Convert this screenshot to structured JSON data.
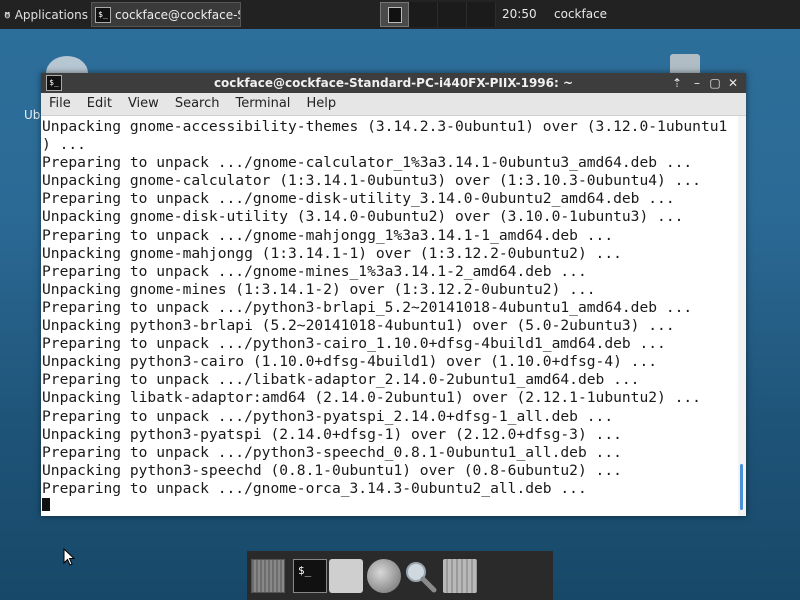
{
  "top_panel": {
    "applications_label": "Applications",
    "task_label": "cockface@cockface-Sta…",
    "clock": "20:50",
    "user": "cockface"
  },
  "desktop": {
    "icon_label_fragment": "Ub an"
  },
  "window": {
    "title": "cockface@cockface-Standard-PC-i440FX-PIIX-1996: ~",
    "menu": [
      "File",
      "Edit",
      "View",
      "Search",
      "Terminal",
      "Help"
    ],
    "lines": [
      "Unpacking gnome-accessibility-themes (3.14.2.3-0ubuntu1) over (3.12.0-1ubuntu1",
      ") ...",
      "Preparing to unpack .../gnome-calculator_1%3a3.14.1-0ubuntu3_amd64.deb ...",
      "Unpacking gnome-calculator (1:3.14.1-0ubuntu3) over (1:3.10.3-0ubuntu4) ...",
      "Preparing to unpack .../gnome-disk-utility_3.14.0-0ubuntu2_amd64.deb ...",
      "Unpacking gnome-disk-utility (3.14.0-0ubuntu2) over (3.10.0-1ubuntu3) ...",
      "Preparing to unpack .../gnome-mahjongg_1%3a3.14.1-1_amd64.deb ...",
      "Unpacking gnome-mahjongg (1:3.14.1-1) over (1:3.12.2-0ubuntu2) ...",
      "Preparing to unpack .../gnome-mines_1%3a3.14.1-2_amd64.deb ...",
      "Unpacking gnome-mines (1:3.14.1-2) over (1:3.12.2-0ubuntu2) ...",
      "Preparing to unpack .../python3-brlapi_5.2~20141018-4ubuntu1_amd64.deb ...",
      "Unpacking python3-brlapi (5.2~20141018-4ubuntu1) over (5.0-2ubuntu3) ...",
      "Preparing to unpack .../python3-cairo_1.10.0+dfsg-4build1_amd64.deb ...",
      "Unpacking python3-cairo (1.10.0+dfsg-4build1) over (1.10.0+dfsg-4) ...",
      "Preparing to unpack .../libatk-adaptor_2.14.0-2ubuntu1_amd64.deb ...",
      "Unpacking libatk-adaptor:amd64 (2.14.0-2ubuntu1) over (2.12.1-1ubuntu2) ...",
      "Preparing to unpack .../python3-pyatspi_2.14.0+dfsg-1_all.deb ...",
      "Unpacking python3-pyatspi (2.14.0+dfsg-1) over (2.12.0+dfsg-3) ...",
      "Preparing to unpack .../python3-speechd_0.8.1-0ubuntu1_all.deb ...",
      "Unpacking python3-speechd (0.8.1-0ubuntu1) over (0.8-6ubuntu2) ...",
      "Preparing to unpack .../gnome-orca_3.14.3-0ubuntu2_all.deb ..."
    ]
  },
  "icons": {
    "terminal_prompt": "$_"
  },
  "colors": {
    "panel_bg": "#222222",
    "title_bar_bg": "#3d3d3d",
    "scroll_thumb": "#4a90d9"
  }
}
